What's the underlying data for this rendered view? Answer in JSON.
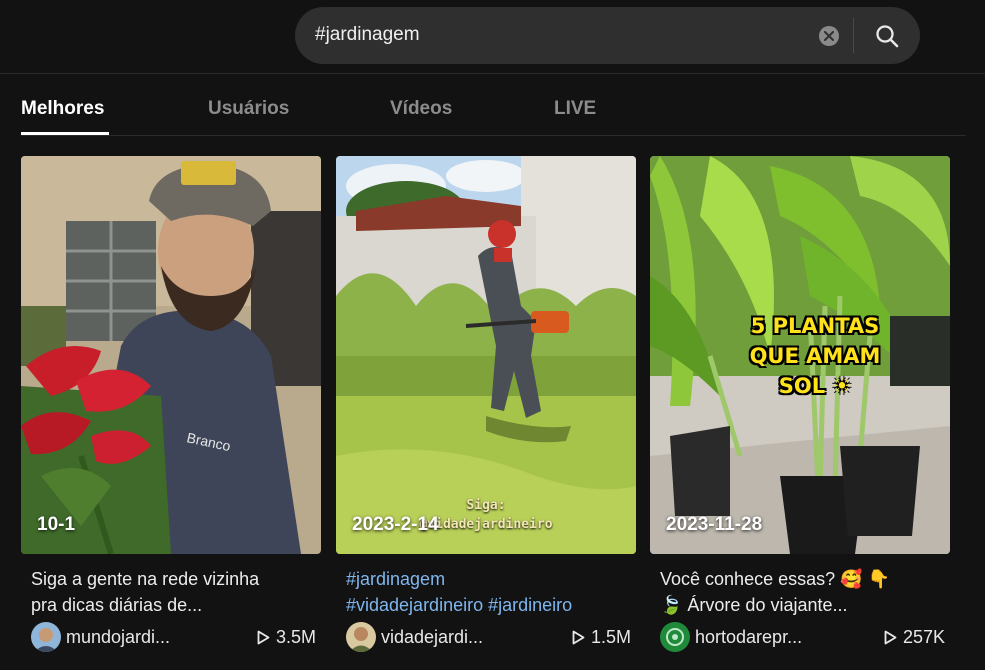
{
  "search": {
    "value": "#jardinagem",
    "clear_icon": "clear-x-icon",
    "search_icon": "search-icon"
  },
  "tabs": [
    {
      "label": "Melhores",
      "active": true
    },
    {
      "label": "Usuários",
      "active": false
    },
    {
      "label": "Vídeos",
      "active": false
    },
    {
      "label": "LIVE",
      "active": false
    }
  ],
  "videos": [
    {
      "date": "10-1",
      "desc_lines": [
        "Siga a gente na rede vizinha",
        "pra dicas diárias de..."
      ],
      "username": "mundojardi...",
      "views": "3.5M",
      "shirt_text": "Branco"
    },
    {
      "date": "2023-2-14",
      "overlay_text": [
        "Siga:",
        "@vidadejardineiro"
      ],
      "desc_tags_line1": [
        "#jardinagem"
      ],
      "desc_tags_line2": [
        "#vidadejardineiro",
        "#jardineiro"
      ],
      "username": "vidadejardi...",
      "views": "1.5M"
    },
    {
      "date": "2023-11-28",
      "overlay_text": [
        "5 PLANTAS",
        "QUE AMAM",
        "SOL ☀"
      ],
      "desc_lines": [
        "Você conhece essas? 🥰 👇",
        "🍃 Árvore do viajante..."
      ],
      "username": "hortodarepr...",
      "views": "257K"
    }
  ],
  "colors": {
    "background": "#121212",
    "search_bg": "#2f2f2f",
    "hashtag": "#7fb6ee",
    "overlay_yellow": "#ffe21a"
  }
}
